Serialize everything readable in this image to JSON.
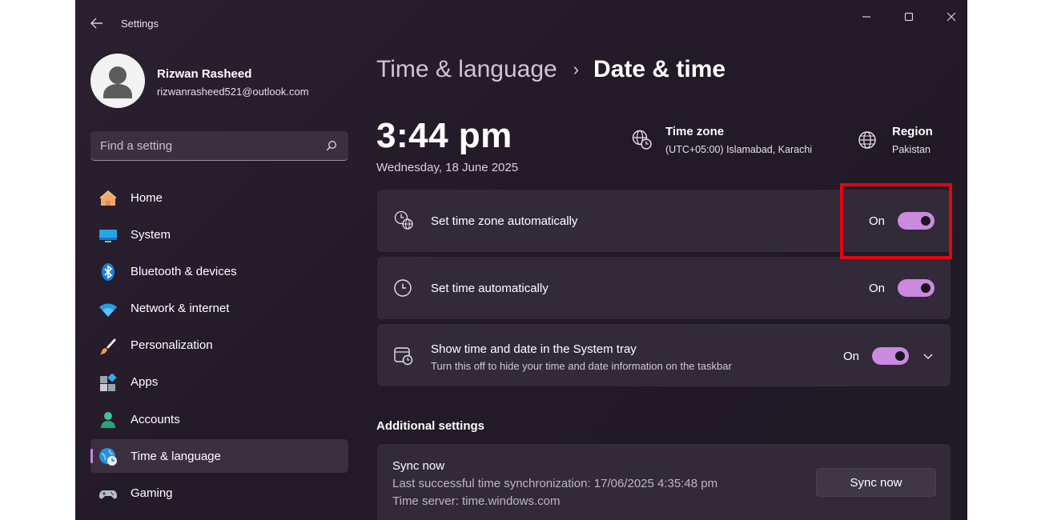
{
  "window": {
    "app_title": "Settings"
  },
  "user": {
    "name": "Rizwan Rasheed",
    "email": "rizwanrasheed521@outlook.com"
  },
  "search": {
    "placeholder": "Find a setting",
    "icon": "search-icon"
  },
  "sidebar": {
    "items": [
      {
        "label": "Home",
        "icon": "home-icon",
        "active": false
      },
      {
        "label": "System",
        "icon": "monitor-icon",
        "active": false
      },
      {
        "label": "Bluetooth & devices",
        "icon": "bluetooth-icon",
        "active": false
      },
      {
        "label": "Network & internet",
        "icon": "wifi-icon",
        "active": false
      },
      {
        "label": "Personalization",
        "icon": "brush-icon",
        "active": false
      },
      {
        "label": "Apps",
        "icon": "apps-icon",
        "active": false
      },
      {
        "label": "Accounts",
        "icon": "person-icon",
        "active": false
      },
      {
        "label": "Time & language",
        "icon": "globe-clock-icon",
        "active": true
      },
      {
        "label": "Gaming",
        "icon": "gamepad-icon",
        "active": false
      }
    ]
  },
  "breadcrumb": {
    "parent": "Time & language",
    "separator": "›",
    "current": "Date & time"
  },
  "clock": {
    "time": "3:44 pm",
    "date": "Wednesday, 18 June 2025"
  },
  "timezone": {
    "title": "Time zone",
    "value": "(UTC+05:00) Islamabad, Karachi"
  },
  "region": {
    "title": "Region",
    "value": "Pakistan"
  },
  "settings": [
    {
      "title": "Set time zone automatically",
      "state_label": "On",
      "enabled": true,
      "icon": "globe-clock-icon"
    },
    {
      "title": "Set time automatically",
      "state_label": "On",
      "enabled": true,
      "icon": "clock-icon"
    },
    {
      "title": "Show time and date in the System tray",
      "subtitle": "Turn this off to hide your time and date information on the taskbar",
      "state_label": "On",
      "enabled": true,
      "icon": "calendar-clock-icon"
    }
  ],
  "additional": {
    "section_title": "Additional settings",
    "sync_title": "Sync now",
    "last_sync": "Last successful time synchronization: 17/06/2025 4:35:48 pm",
    "time_server": "Time server: time.windows.com",
    "sync_button": "Sync now"
  },
  "colors": {
    "accent": "#c98ae0",
    "highlight": "#e30613"
  }
}
